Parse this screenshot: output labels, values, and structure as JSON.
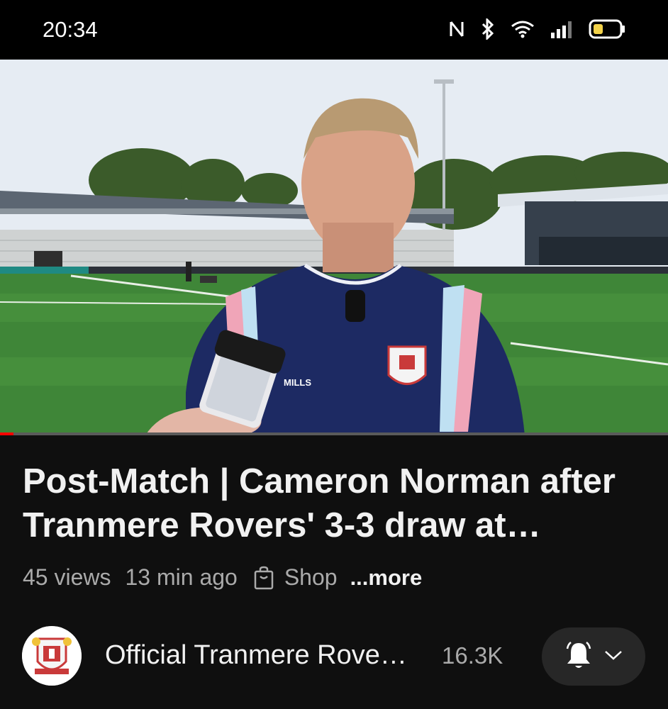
{
  "status_bar": {
    "time": "20:34",
    "icons": [
      "nfc-icon",
      "bluetooth-icon",
      "wifi-icon",
      "signal-icon",
      "battery-icon"
    ],
    "battery_level": 0.3
  },
  "video": {
    "description_icon": "video-player",
    "progress": 0.02,
    "progress_color": "#ff0000"
  },
  "title": "Post-Match | Cameron Norman after Tranmere Rovers' 3-3 draw at…",
  "meta": {
    "views": "45 views",
    "age": "13 min ago",
    "shop_label": "Shop",
    "more_label": "...more"
  },
  "channel": {
    "name": "Official Tranmere Rove…",
    "subscribers": "16.3K",
    "avatar_icon": "club-crest-icon",
    "notification_icon": "bell-icon"
  },
  "colors": {
    "background": "#0f0f0f",
    "text_primary": "#f1f1f1",
    "text_secondary": "#aaaaaa",
    "button_bg": "#272727"
  }
}
